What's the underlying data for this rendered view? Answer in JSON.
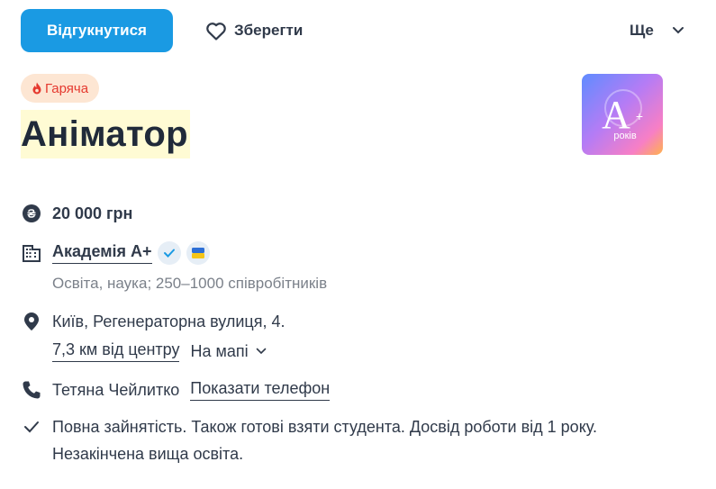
{
  "toolbar": {
    "apply_label": "Відгукнутися",
    "save_label": "Зберегти",
    "more_label": "Ще"
  },
  "badge": {
    "label": "Гаряча"
  },
  "title": "Аніматор",
  "logo": {
    "main": "A+",
    "caption": "років"
  },
  "salary": "20 000 грн",
  "company": {
    "name": "Академія A+",
    "details": "Освіта, наука; 250–1000 співробітників"
  },
  "location": {
    "address": "Київ, Регенераторна вулиця, 4.",
    "distance": "7,3 км від центру",
    "map_label": "На мапі"
  },
  "contact": {
    "name": "Тетяна Чейлитко",
    "phone_label": "Показати телефон"
  },
  "requirements": {
    "line1": "Повна зайнятість. Також готові взяти студента. Досвід роботи від 1 року.",
    "line2": "Незакінчена вища освіта."
  },
  "colors": {
    "primary": "#1a9ae3",
    "text": "#303a4a",
    "hot": "#e5392f",
    "hot_bg": "#fde6d3",
    "highlight": "#fffbd4",
    "muted": "#7b818a"
  }
}
